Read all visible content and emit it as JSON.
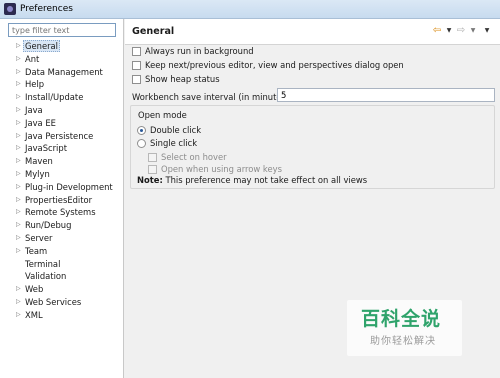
{
  "window": {
    "title": "Preferences"
  },
  "filter": {
    "placeholder": "type filter text"
  },
  "tree": {
    "items": [
      {
        "label": "General",
        "expandable": true,
        "selected": true
      },
      {
        "label": "Ant",
        "expandable": true
      },
      {
        "label": "Data Management",
        "expandable": true
      },
      {
        "label": "Help",
        "expandable": true
      },
      {
        "label": "Install/Update",
        "expandable": true
      },
      {
        "label": "Java",
        "expandable": true
      },
      {
        "label": "Java EE",
        "expandable": true
      },
      {
        "label": "Java Persistence",
        "expandable": true
      },
      {
        "label": "JavaScript",
        "expandable": true
      },
      {
        "label": "Maven",
        "expandable": true
      },
      {
        "label": "Mylyn",
        "expandable": true
      },
      {
        "label": "Plug-in Development",
        "expandable": true
      },
      {
        "label": "PropertiesEditor",
        "expandable": true
      },
      {
        "label": "Remote Systems",
        "expandable": true
      },
      {
        "label": "Run/Debug",
        "expandable": true
      },
      {
        "label": "Server",
        "expandable": true
      },
      {
        "label": "Team",
        "expandable": true
      },
      {
        "label": "Terminal",
        "expandable": false
      },
      {
        "label": "Validation",
        "expandable": false
      },
      {
        "label": "Web",
        "expandable": true
      },
      {
        "label": "Web Services",
        "expandable": true
      },
      {
        "label": "XML",
        "expandable": true
      }
    ]
  },
  "page": {
    "title": "General",
    "nav": {
      "back_icon": "back-arrow-icon",
      "forward_icon": "forward-arrow-icon"
    },
    "checkboxes": [
      {
        "label": "Always run in background",
        "checked": false
      },
      {
        "label": "Keep next/previous editor, view and perspectives dialog open",
        "checked": false
      },
      {
        "label": "Show heap status",
        "checked": false
      }
    ],
    "interval": {
      "label": "Workbench save interval (in minutes):",
      "value": "5"
    },
    "open_mode": {
      "title": "Open mode",
      "double_click": "Double click",
      "single_click": "Single click",
      "selected": "double_click",
      "select_on_hover": "Select on hover",
      "open_with_arrow_keys": "Open when using arrow keys",
      "note_label": "Note:",
      "note_text": "This preference may not take effect on all views"
    }
  },
  "watermark": {
    "main": "百科全说",
    "sub": "助你轻松解决"
  },
  "colors": {
    "accent": "#d9e6f5",
    "watermark_green": "#2fa36b",
    "back_arrow": "#d98a12"
  }
}
